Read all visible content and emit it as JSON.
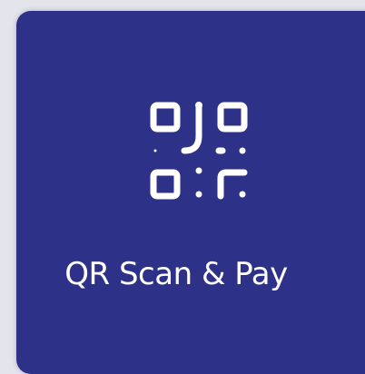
{
  "tile": {
    "label": "QR Scan & Pay",
    "icon": "qr-code-icon",
    "background_color": "#2d3187",
    "text_color": "#ffffff"
  }
}
